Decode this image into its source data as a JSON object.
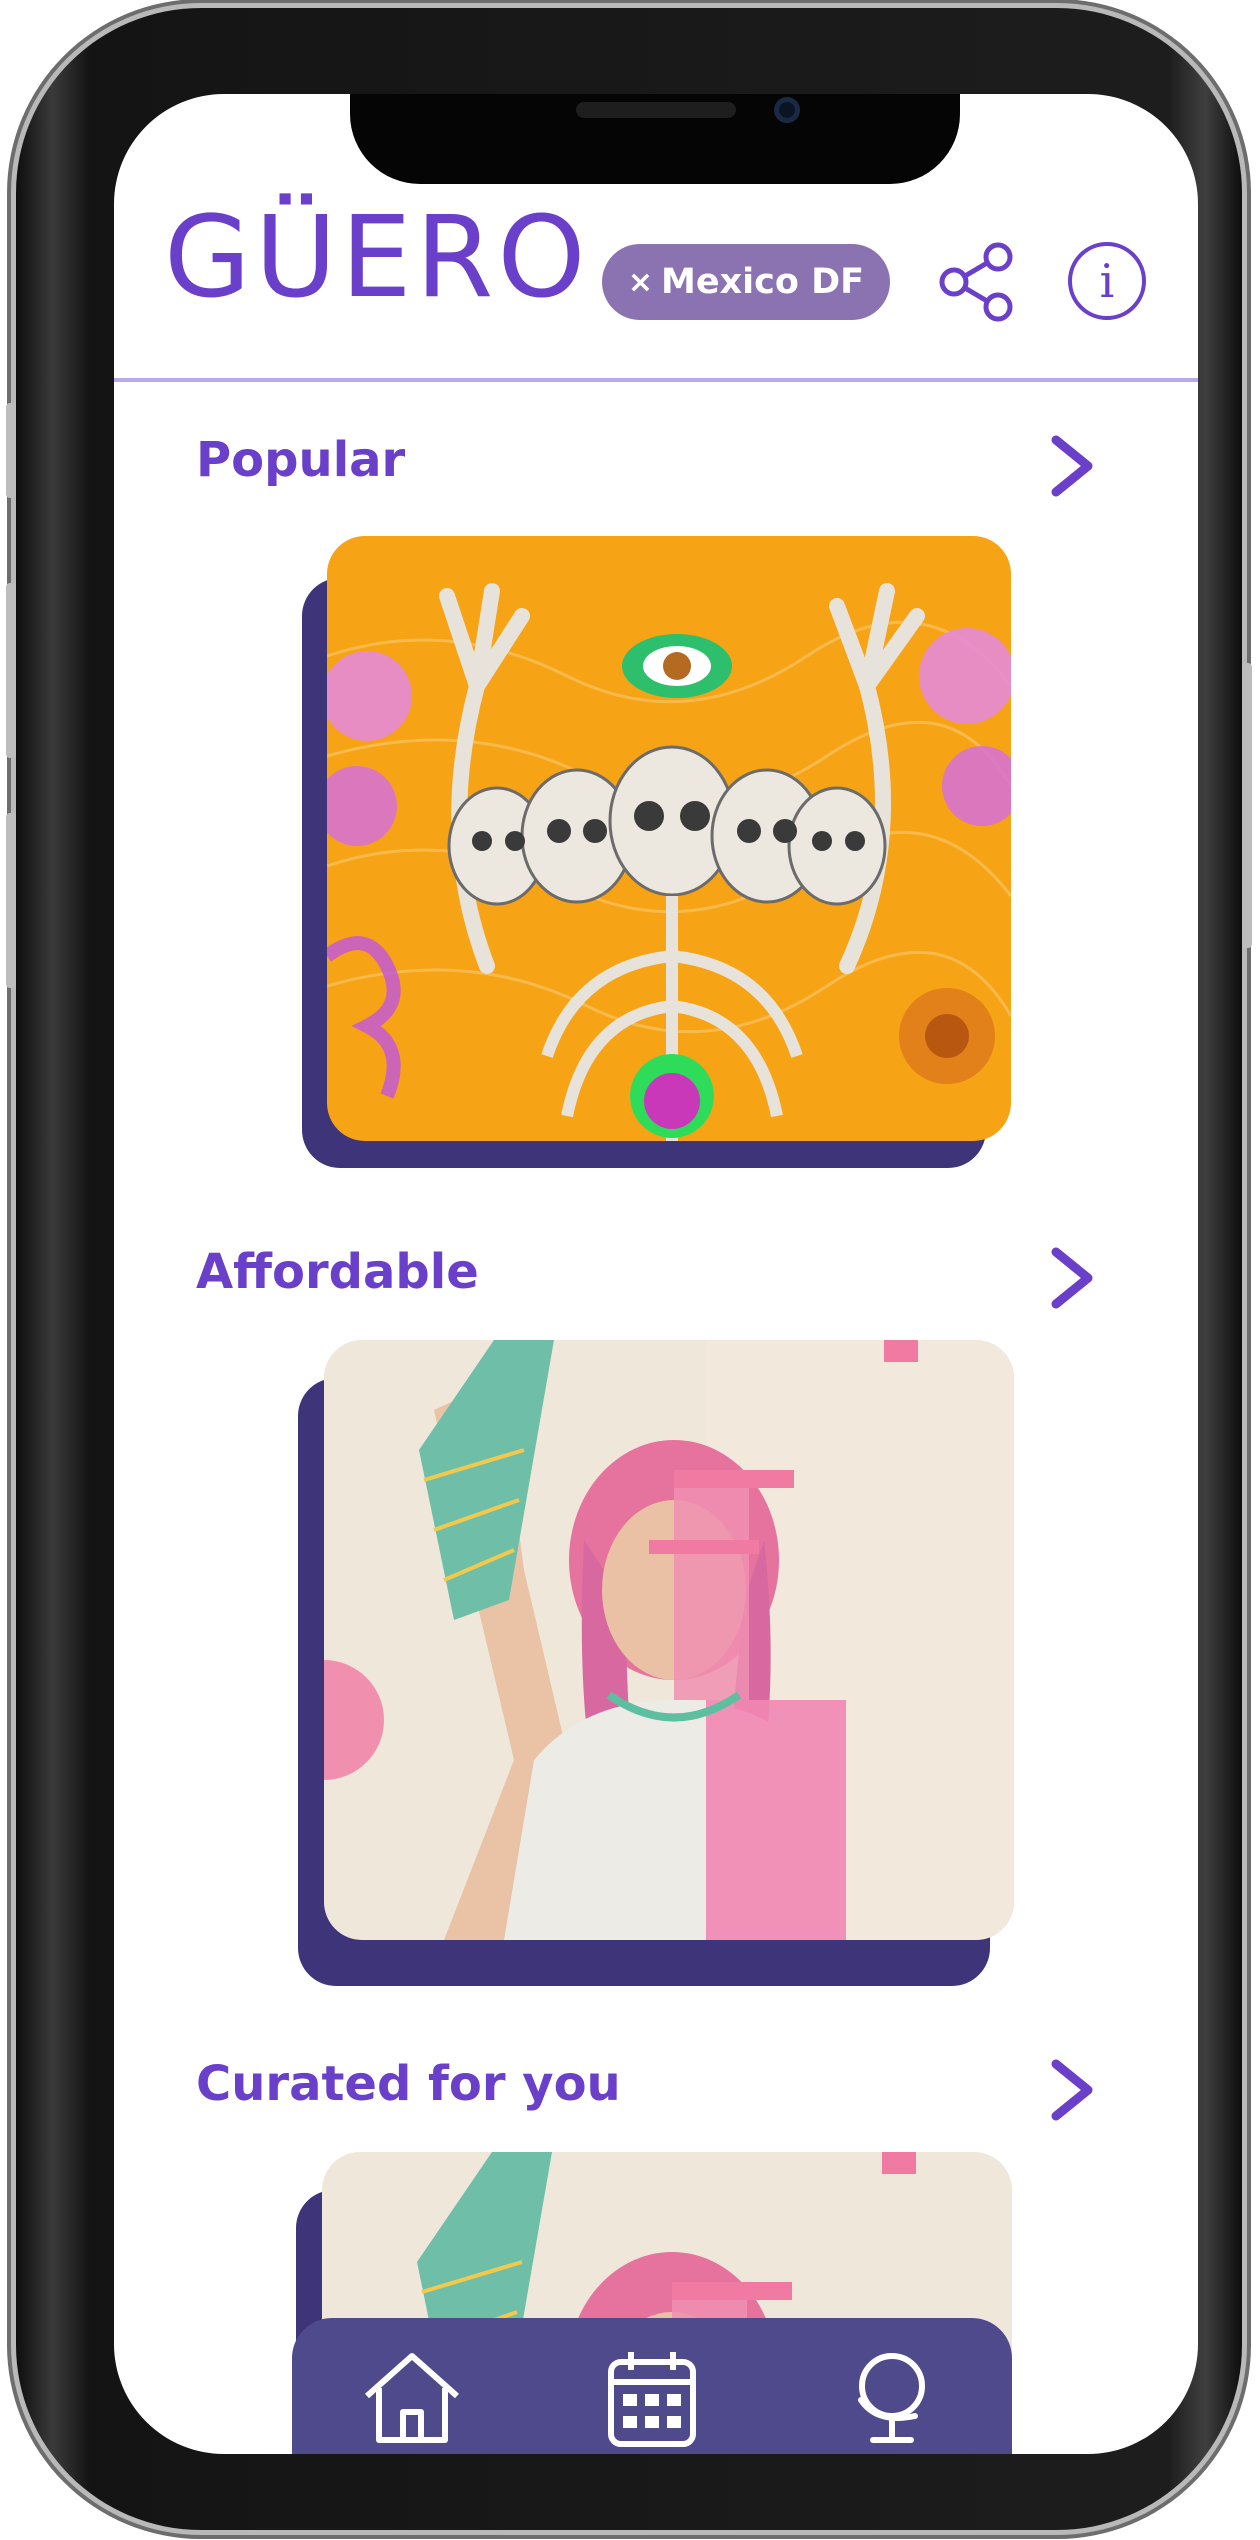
{
  "app": {
    "logo": "GÜERO"
  },
  "header": {
    "city_x": "×",
    "city": "Mexico DF",
    "share_icon": "share-icon",
    "info_icon": "info-icon",
    "info_glyph": "i"
  },
  "sections": [
    {
      "title": "Popular",
      "image": "day-of-the-dead-skeleton-artwork"
    },
    {
      "title": "Affordable",
      "image": "pink-haired-artist-portrait"
    },
    {
      "title": "Curated for you",
      "image": "pink-haired-artist-portrait"
    }
  ],
  "tabbar": {
    "items": [
      "home-icon",
      "calendar-icon",
      "globe-icon"
    ]
  },
  "colors": {
    "brand_purple": "#6a3fc9",
    "pill": "#8b72b0",
    "card_shadow": "#3d347a",
    "tabbar": "#4f4a8c",
    "divider": "#b9a8ec"
  }
}
